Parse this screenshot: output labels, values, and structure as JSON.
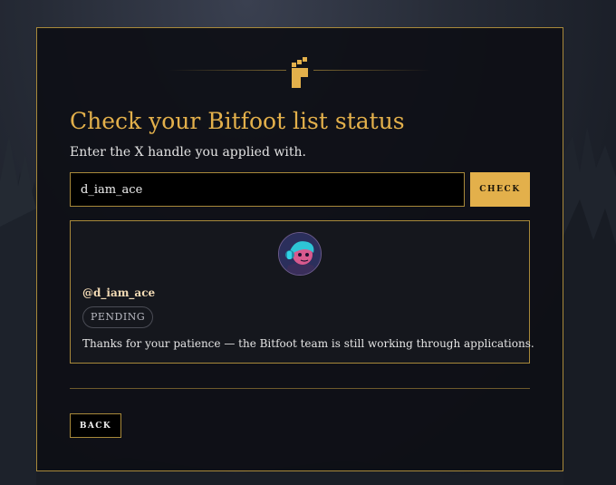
{
  "theme": {
    "accent": "#e3b04b",
    "panel_bg": "#0e0f15",
    "border": "#a8893a"
  },
  "header": {
    "logo_icon": "bitfoot-logo-icon"
  },
  "form": {
    "title": "Check your Bitfoot list status",
    "subtitle": "Enter the X handle you applied with.",
    "handle_value": "d_iam_ace",
    "check_label": "CHECK"
  },
  "result": {
    "avatar_icon": "user-avatar",
    "handle": "@d_iam_ace",
    "status": "PENDING",
    "message": "Thanks for your patience — the Bitfoot team is still working through applications."
  },
  "footer": {
    "back_label": "BACK"
  }
}
